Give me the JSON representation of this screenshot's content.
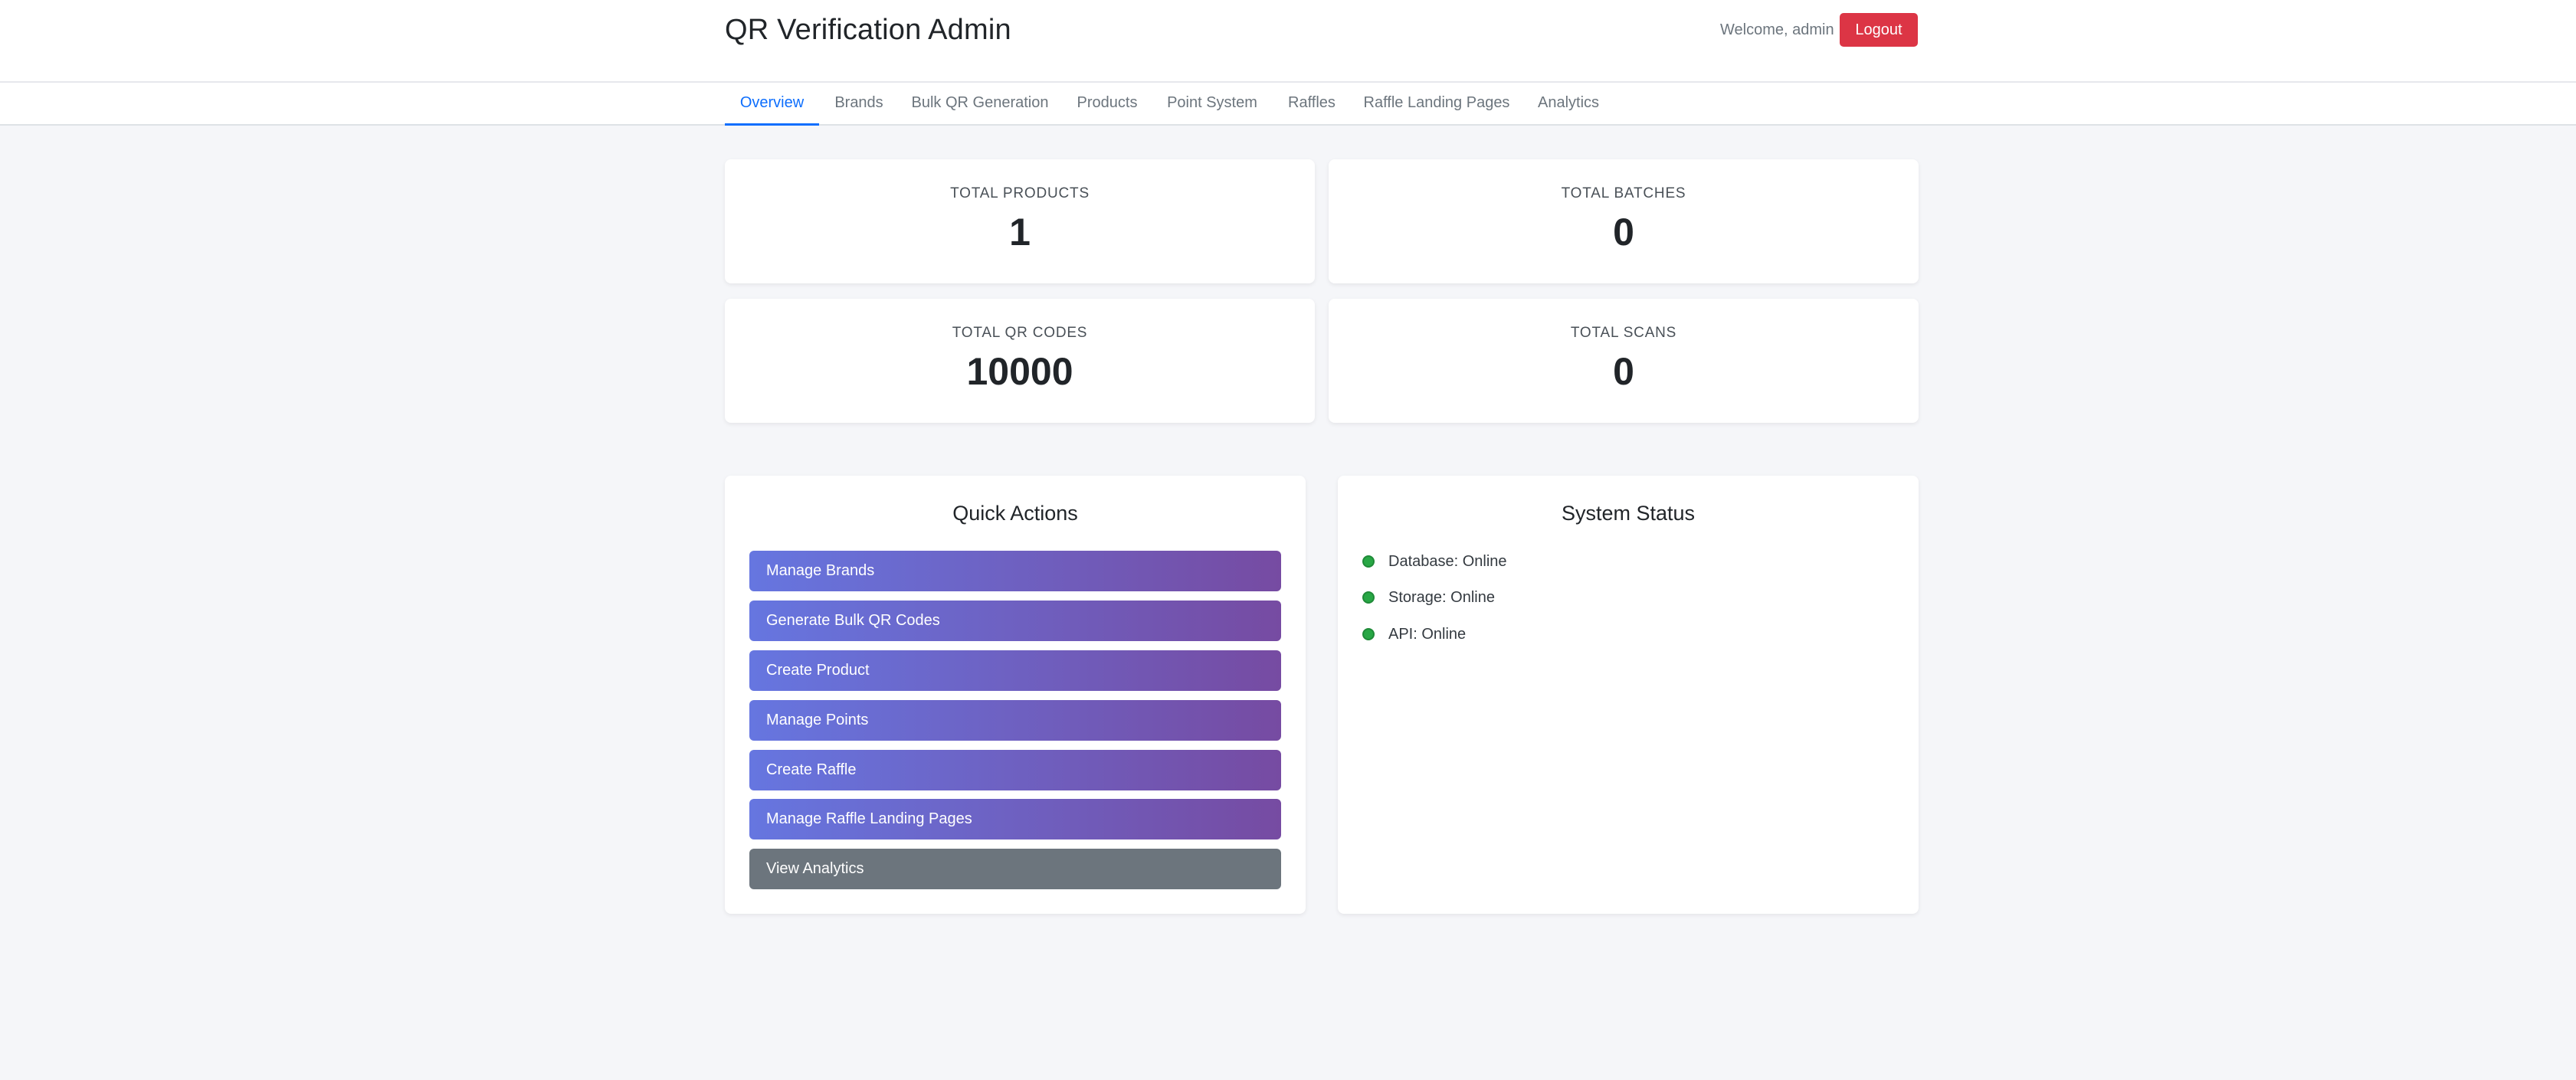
{
  "header": {
    "title": "QR Verification Admin",
    "welcome": "Welcome, admin",
    "logout_label": "Logout"
  },
  "nav": {
    "tabs": [
      {
        "label": "Overview",
        "active": true
      },
      {
        "label": "Brands"
      },
      {
        "label": "Bulk QR Generation"
      },
      {
        "label": "Products"
      },
      {
        "label": "Point System"
      },
      {
        "label": "Raffles"
      },
      {
        "label": "Raffle Landing Pages"
      },
      {
        "label": "Analytics"
      }
    ]
  },
  "stats": [
    {
      "label": "TOTAL PRODUCTS",
      "value": "1"
    },
    {
      "label": "TOTAL BATCHES",
      "value": "0"
    },
    {
      "label": "TOTAL QR CODES",
      "value": "10000"
    },
    {
      "label": "TOTAL SCANS",
      "value": "0"
    }
  ],
  "quick_actions": {
    "title": "Quick Actions",
    "buttons": [
      {
        "label": "Manage Brands"
      },
      {
        "label": "Generate Bulk QR Codes"
      },
      {
        "label": "Create Product"
      },
      {
        "label": "Manage Points"
      },
      {
        "label": "Create Raffle"
      },
      {
        "label": "Manage Raffle Landing Pages"
      },
      {
        "label": "View Analytics"
      }
    ]
  },
  "system_status": {
    "title": "System Status",
    "items": [
      {
        "label": "Database: Online"
      },
      {
        "label": "Storage: Online"
      },
      {
        "label": "API: Online"
      }
    ],
    "online_color": "#28a745"
  },
  "colors": {
    "accent": "#0d6efd",
    "danger": "#dc3545",
    "gradient_start": "#6676e0",
    "gradient_end": "#764ba2",
    "secondary": "#6c757d"
  }
}
